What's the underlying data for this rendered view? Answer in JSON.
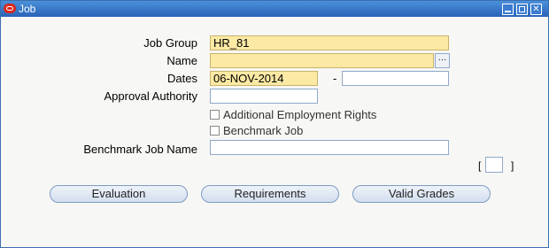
{
  "window": {
    "title": "Job",
    "min_glyph": "",
    "max_glyph": "",
    "close_glyph": "✕"
  },
  "form": {
    "job_group": {
      "label": "Job Group",
      "value": "HR_81"
    },
    "name": {
      "label": "Name",
      "value": "",
      "lov_glyph": "···"
    },
    "dates": {
      "label": "Dates",
      "from": "06-NOV-2014",
      "separator": "-",
      "to": ""
    },
    "approval_authority": {
      "label": "Approval Authority",
      "value": ""
    },
    "additional_employment_rights": {
      "label": "Additional Employment Rights",
      "checked": false
    },
    "benchmark_job": {
      "label": "Benchmark Job",
      "checked": false
    },
    "benchmark_job_name": {
      "label": "Benchmark Job Name",
      "value": ""
    },
    "bracket_open": "[",
    "bracket_close": "]"
  },
  "buttons": {
    "evaluation": "Evaluation",
    "requirements": "Requirements",
    "valid_grades": "Valid Grades"
  }
}
